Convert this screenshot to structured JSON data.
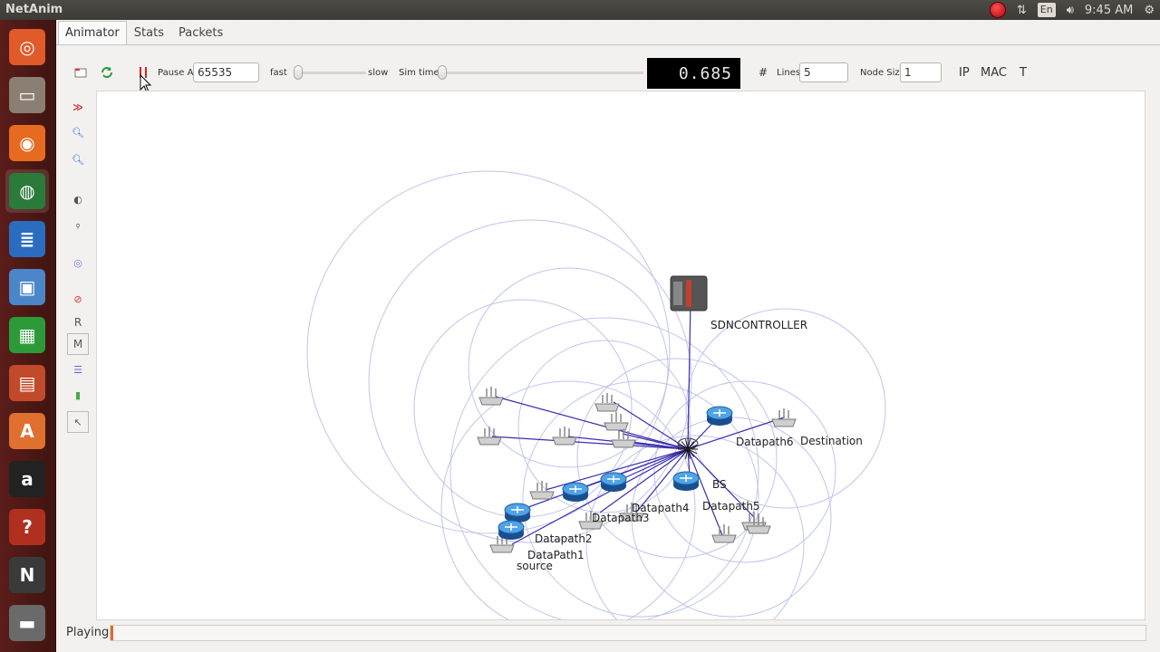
{
  "window": {
    "title": "NetAnim"
  },
  "tray": {
    "clock": "9:45 AM",
    "keyboard": "En",
    "icons": [
      "record-icon",
      "network-icon",
      "keyboard-icon",
      "volume-icon",
      "settings-icon"
    ]
  },
  "launcher": {
    "items": [
      {
        "name": "dash-icon",
        "color": "#e05a2a",
        "glyph": "◎"
      },
      {
        "name": "files-icon",
        "color": "#8a7f72",
        "glyph": "▭"
      },
      {
        "name": "firefox-icon",
        "color": "#e66a1f",
        "glyph": "◉"
      },
      {
        "name": "globe-icon",
        "color": "#2a7a3a",
        "glyph": "◍"
      },
      {
        "name": "writer-icon",
        "color": "#2a6cc0",
        "glyph": "≣"
      },
      {
        "name": "virtualbox-icon",
        "color": "#4a86c8",
        "glyph": "▣"
      },
      {
        "name": "calc-icon",
        "color": "#2d9a3a",
        "glyph": "▦"
      },
      {
        "name": "impress-icon",
        "color": "#c04a2a",
        "glyph": "▤"
      },
      {
        "name": "software-center-icon",
        "color": "#e07030",
        "glyph": "A"
      },
      {
        "name": "amazon-icon",
        "color": "#222222",
        "glyph": "a"
      },
      {
        "name": "system-settings-icon",
        "color": "#b03020",
        "glyph": "?"
      },
      {
        "name": "terminal-icon",
        "color": "#3a3a3a",
        "glyph": "N"
      },
      {
        "name": "trash-icon",
        "color": "#6a6a6a",
        "glyph": "▬"
      }
    ]
  },
  "tabs": [
    {
      "label": "Animator",
      "active": true
    },
    {
      "label": "Stats",
      "active": false
    },
    {
      "label": "Packets",
      "active": false
    }
  ],
  "toolbar": {
    "pause_at_label": "Pause At",
    "pause_at_value": "65535",
    "fast_label": "fast",
    "slow_label": "slow",
    "sim_time_label": "Sim time",
    "sim_time_value": "0.685",
    "grid_symbol": "#",
    "lines_label": "Lines",
    "lines_value": "5",
    "node_size_label": "Node Size",
    "node_size_value": "1",
    "ip_label": "IP",
    "mac_label": "MAC",
    "t_label": "T"
  },
  "sidetools": [
    "expand-icon",
    "zoom-in-icon",
    "zoom-out-icon",
    "background-image-icon",
    "mobility-icon",
    "fingerprint-icon",
    "disable-icon",
    "R",
    "M",
    "list-icon",
    "battery-icon",
    "pointer-icon"
  ],
  "sidetool_text": {
    "r": "R",
    "m": "M"
  },
  "scene": {
    "labels": {
      "controller": "SDNCONTROLLER",
      "bs": "BS",
      "datapath6": "Datapath6",
      "destination": "Destination",
      "datapath5": "Datapath5",
      "datapath4": "Datapath4",
      "datapath3": "Datapath3",
      "datapath2": "Datapath2",
      "datapath1": "DataPath1",
      "source": "source"
    }
  },
  "status": {
    "text": "Playing",
    "progress": 0.002,
    "progress_color": "#e06a2b"
  }
}
